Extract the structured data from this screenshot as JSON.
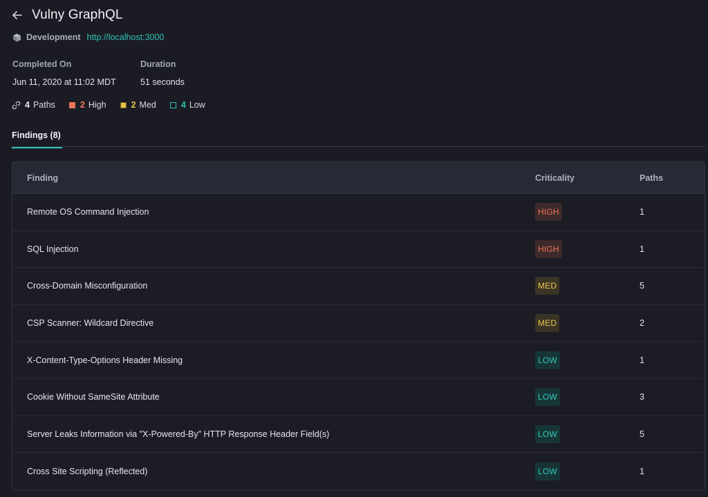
{
  "header": {
    "title": "Vulny GraphQL"
  },
  "environment": {
    "name": "Development",
    "url": "http://localhost:3000",
    "icon": "cube-icon"
  },
  "meta": {
    "completed_label": "Completed On",
    "completed_value": "Jun 11, 2020 at 11:02 MDT",
    "duration_label": "Duration",
    "duration_value": "51 seconds"
  },
  "stats": {
    "paths": {
      "count": "4",
      "label": "Paths"
    },
    "high": {
      "count": "2",
      "label": "High"
    },
    "med": {
      "count": "2",
      "label": "Med"
    },
    "low": {
      "count": "4",
      "label": "Low"
    }
  },
  "tabs": [
    {
      "label": "Findings (8)",
      "active": true
    }
  ],
  "table": {
    "headers": {
      "finding": "Finding",
      "criticality": "Criticality",
      "paths": "Paths"
    },
    "rows": [
      {
        "finding": "Remote OS Command Injection",
        "criticality": "HIGH",
        "level": "high",
        "paths": "1"
      },
      {
        "finding": "SQL Injection",
        "criticality": "HIGH",
        "level": "high",
        "paths": "1"
      },
      {
        "finding": "Cross-Domain Misconfiguration",
        "criticality": "MED",
        "level": "med",
        "paths": "5"
      },
      {
        "finding": "CSP Scanner: Wildcard Directive",
        "criticality": "MED",
        "level": "med",
        "paths": "2"
      },
      {
        "finding": "X-Content-Type-Options Header Missing",
        "criticality": "LOW",
        "level": "low",
        "paths": "1"
      },
      {
        "finding": "Cookie Without SameSite Attribute",
        "criticality": "LOW",
        "level": "low",
        "paths": "3"
      },
      {
        "finding": "Server Leaks Information via \"X-Powered-By\" HTTP Response Header Field(s)",
        "criticality": "LOW",
        "level": "low",
        "paths": "5"
      },
      {
        "finding": "Cross Site Scripting (Reflected)",
        "criticality": "LOW",
        "level": "low",
        "paths": "1"
      }
    ]
  },
  "colors": {
    "accent": "#2fc1b5",
    "high": "#ef7356",
    "med": "#efc84c",
    "low": "#35c6ba",
    "background": "#1b1b24"
  }
}
